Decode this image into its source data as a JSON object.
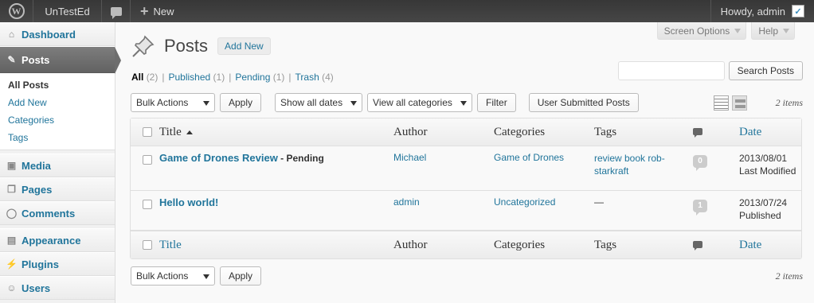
{
  "adminbar": {
    "site_name": "UnTestEd",
    "new_label": "New",
    "howdy": "Howdy, admin"
  },
  "sidebar": {
    "items": [
      {
        "label": "Dashboard",
        "icon": "dashboard-icon"
      },
      {
        "label": "Posts",
        "icon": "pushpin-icon"
      },
      {
        "label": "Media",
        "icon": "media-icon"
      },
      {
        "label": "Pages",
        "icon": "pages-icon"
      },
      {
        "label": "Comments",
        "icon": "comments-icon"
      },
      {
        "label": "Appearance",
        "icon": "appearance-icon"
      },
      {
        "label": "Plugins",
        "icon": "plugins-icon"
      },
      {
        "label": "Users",
        "icon": "users-icon"
      }
    ],
    "posts_submenu": [
      "All Posts",
      "Add New",
      "Categories",
      "Tags"
    ]
  },
  "screen_meta": {
    "screen_options": "Screen Options",
    "help": "Help"
  },
  "page": {
    "title": "Posts",
    "add_new": "Add New"
  },
  "views": {
    "all": {
      "label": "All",
      "count": "(2)"
    },
    "published": {
      "label": "Published",
      "count": "(1)"
    },
    "pending": {
      "label": "Pending",
      "count": "(1)"
    },
    "trash": {
      "label": "Trash",
      "count": "(4)"
    },
    "separator": "|"
  },
  "search": {
    "button": "Search Posts",
    "value": ""
  },
  "tablenav_top": {
    "bulk_actions": "Bulk Actions",
    "apply": "Apply",
    "dates": "Show all dates",
    "categories": "View all categories",
    "filter": "Filter",
    "user_submitted": "User Submitted Posts",
    "count": "2 items"
  },
  "table": {
    "columns": {
      "title": "Title",
      "author": "Author",
      "categories": "Categories",
      "tags": "Tags",
      "date": "Date"
    },
    "rows": [
      {
        "title": "Game of Drones Review",
        "state": " - Pending",
        "author": "Michael",
        "categories": "Game of Drones",
        "tags": "review book rob-starkraft",
        "comments": "0",
        "date": "2013/08/01",
        "date_status": "Last Modified"
      },
      {
        "title": "Hello world!",
        "state": "",
        "author": "admin",
        "categories": "Uncategorized",
        "tags": "—",
        "comments": "1",
        "date": "2013/07/24",
        "date_status": "Published"
      }
    ]
  },
  "tablenav_bottom": {
    "bulk_actions": "Bulk Actions",
    "apply": "Apply",
    "count": "2 items"
  },
  "colors": {
    "link": "#21759b",
    "adminbar": "#464646",
    "current_menu": "#6d6d6d"
  }
}
